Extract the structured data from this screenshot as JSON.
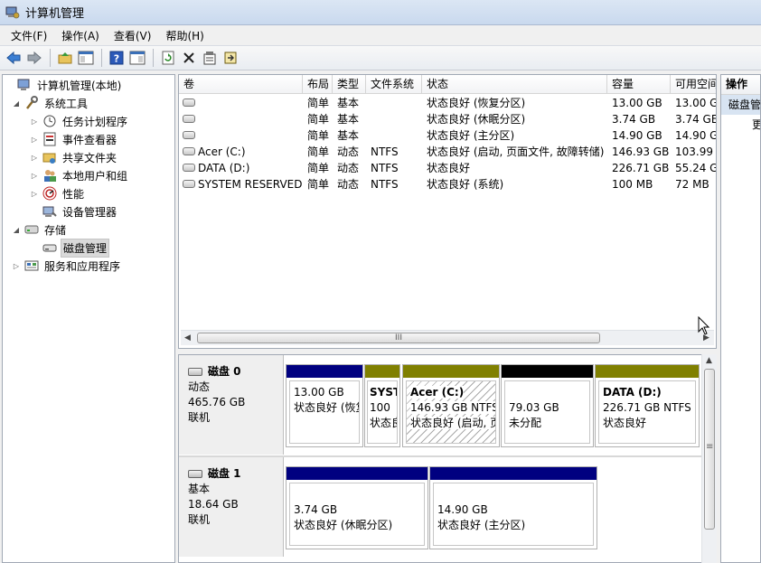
{
  "window": {
    "title": "计算机管理"
  },
  "menu": [
    "文件(F)",
    "操作(A)",
    "查看(V)",
    "帮助(H)"
  ],
  "toolbar_icons": [
    "back-arrow-icon",
    "forward-arrow-icon",
    "up-folder-icon",
    "show-hide-tree-icon",
    "help-icon",
    "console-view-icon",
    "refresh-icon",
    "delete-icon",
    "properties-icon",
    "export-icon"
  ],
  "tree": [
    {
      "label": "计算机管理(本地)",
      "icon": "computer-icon",
      "expander": ""
    },
    {
      "label": "系统工具",
      "icon": "tools-icon",
      "expander": "◢"
    },
    {
      "label": "任务计划程序",
      "icon": "clock-icon",
      "expander": "▷"
    },
    {
      "label": "事件查看器",
      "icon": "event-viewer-icon",
      "expander": "▷"
    },
    {
      "label": "共享文件夹",
      "icon": "shared-folder-icon",
      "expander": "▷"
    },
    {
      "label": "本地用户和组",
      "icon": "users-icon",
      "expander": "▷"
    },
    {
      "label": "性能",
      "icon": "performance-icon",
      "expander": "▷"
    },
    {
      "label": "设备管理器",
      "icon": "device-manager-icon",
      "expander": ""
    },
    {
      "label": "存储",
      "icon": "storage-icon",
      "expander": "◢"
    },
    {
      "label": "磁盘管理",
      "icon": "disk-management-icon",
      "expander": ""
    },
    {
      "label": "服务和应用程序",
      "icon": "services-icon",
      "expander": "▷"
    }
  ],
  "volumes": {
    "headers": [
      "卷",
      "布局",
      "类型",
      "文件系统",
      "状态",
      "容量",
      "可用空间"
    ],
    "rows": [
      {
        "name": "",
        "layout": "简单",
        "type": "基本",
        "fs": "",
        "status": "状态良好 (恢复分区)",
        "capacity": "13.00 GB",
        "free": "13.00 G"
      },
      {
        "name": "",
        "layout": "简单",
        "type": "基本",
        "fs": "",
        "status": "状态良好 (休眠分区)",
        "capacity": "3.74 GB",
        "free": "3.74 GE"
      },
      {
        "name": "",
        "layout": "简单",
        "type": "基本",
        "fs": "",
        "status": "状态良好 (主分区)",
        "capacity": "14.90 GB",
        "free": "14.90 G"
      },
      {
        "name": "Acer (C:)",
        "layout": "简单",
        "type": "动态",
        "fs": "NTFS",
        "status": "状态良好 (启动, 页面文件, 故障转储)",
        "capacity": "146.93 GB",
        "free": "103.99"
      },
      {
        "name": "DATA (D:)",
        "layout": "简单",
        "type": "动态",
        "fs": "NTFS",
        "status": "状态良好",
        "capacity": "226.71 GB",
        "free": "55.24 G"
      },
      {
        "name": "SYSTEM RESERVED",
        "layout": "简单",
        "type": "动态",
        "fs": "NTFS",
        "status": "状态良好 (系统)",
        "capacity": "100 MB",
        "free": "72 MB"
      }
    ]
  },
  "disks": [
    {
      "title": "磁盘 0",
      "kind": "动态",
      "size": "465.76 GB",
      "state": "联机",
      "partitions": [
        {
          "name": "",
          "line1": "13.00 GB",
          "line2": "状态良好 (恢复",
          "color": "#000080"
        },
        {
          "name": "SYST",
          "line1": "100",
          "line2": "状态良",
          "color": "#808000"
        },
        {
          "name": "Acer  (C:)",
          "line1": "146.93 GB NTFS",
          "line2": "状态良好 (启动, 页",
          "color": "#808000"
        },
        {
          "name": "",
          "line1": "79.03 GB",
          "line2": "未分配",
          "color": "#000000"
        },
        {
          "name": "DATA  (D:)",
          "line1": "226.71 GB NTFS",
          "line2": "状态良好",
          "color": "#808000"
        }
      ]
    },
    {
      "title": "磁盘 1",
      "kind": "基本",
      "size": "18.64 GB",
      "state": "联机",
      "partitions": [
        {
          "name": "",
          "line1": "3.74 GB",
          "line2": "状态良好 (休眠分区)",
          "color": "#000080"
        },
        {
          "name": "",
          "line1": "14.90 GB",
          "line2": "状态良好 (主分区)",
          "color": "#000080"
        }
      ]
    }
  ],
  "actions": {
    "header": "操作",
    "group": "磁盘管理",
    "item": "更多操作"
  },
  "scroll_thumb": "III",
  "grip": "≡"
}
